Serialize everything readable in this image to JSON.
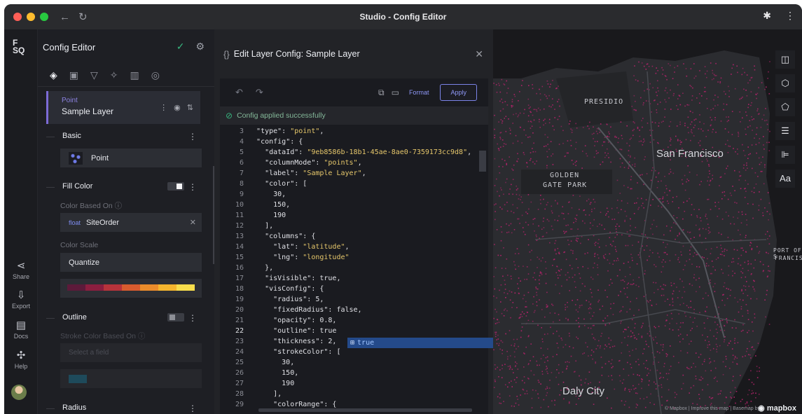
{
  "window": {
    "title": "Studio - Config Editor"
  },
  "titlebar": {
    "back_icon": "back-arrow-icon",
    "reload_icon": "reload-icon",
    "extensions_icon": "puzzle-icon",
    "menu_icon": "kebab-icon"
  },
  "rail": {
    "logo": "FSQ",
    "items": [
      {
        "label": "Share",
        "icon": "share-icon"
      },
      {
        "label": "Export",
        "icon": "export-icon"
      },
      {
        "label": "Docs",
        "icon": "docs-icon"
      },
      {
        "label": "Help",
        "icon": "help-icon"
      }
    ]
  },
  "sidepanel": {
    "title": "Config Editor",
    "tabs": [
      "layers",
      "interactions",
      "filters",
      "effects",
      "basemap",
      "search"
    ],
    "layer": {
      "type": "Point",
      "name": "Sample Layer"
    },
    "basic": {
      "label": "Basic",
      "value": "Point"
    },
    "fill": {
      "label": "Fill Color",
      "enabled": true,
      "based_on_label": "Color Based On",
      "field_type": "float",
      "field_name": "SiteOrder",
      "scale_label": "Color Scale",
      "scale_value": "Quantize"
    },
    "color_ramp": [
      "#5c1a3a",
      "#8b1e3f",
      "#b8333b",
      "#d85b2e",
      "#eb8c2b",
      "#f4b52e",
      "#f7dd4c"
    ],
    "outline": {
      "label": "Outline",
      "enabled": false,
      "stroke_label": "Stroke Color Based On",
      "stroke_placeholder": "Select a field"
    },
    "radius": {
      "label": "Radius"
    }
  },
  "editor": {
    "title": "Edit Layer Config: Sample Layer",
    "format_label": "Format",
    "apply_label": "Apply",
    "success_message": "Config applied successfully",
    "autocomplete": "true",
    "lines": [
      {
        "n": "3",
        "html": "  <span class='k'>\"type\"</span>: <span class='s'>\"point\"</span>,"
      },
      {
        "n": "4",
        "html": "  <span class='k'>\"config\"</span>: {"
      },
      {
        "n": "5",
        "html": "    <span class='k'>\"dataId\"</span>: <span class='s'>\"9eb8586b-18b1-45ae-8ae0-7359173cc9d8\"</span>,"
      },
      {
        "n": "6",
        "html": "    <span class='k'>\"columnMode\"</span>: <span class='s'>\"points\"</span>,"
      },
      {
        "n": "7",
        "html": "    <span class='k'>\"label\"</span>: <span class='s'>\"Sample Layer\"</span>,"
      },
      {
        "n": "8",
        "html": "    <span class='k'>\"color\"</span>: ["
      },
      {
        "n": "9",
        "html": "      30,"
      },
      {
        "n": "10",
        "html": "      150,"
      },
      {
        "n": "11",
        "html": "      190"
      },
      {
        "n": "12",
        "html": "    ],"
      },
      {
        "n": "13",
        "html": "    <span class='k'>\"columns\"</span>: {"
      },
      {
        "n": "14",
        "html": "      <span class='k'>\"lat\"</span>: <span class='s'>\"latitude\"</span>,"
      },
      {
        "n": "15",
        "html": "      <span class='k'>\"lng\"</span>: <span class='s'>\"longitude\"</span>"
      },
      {
        "n": "16",
        "html": "    },"
      },
      {
        "n": "17",
        "html": "    <span class='k'>\"isVisible\"</span>: true,"
      },
      {
        "n": "18",
        "html": "    <span class='k'>\"visConfig\"</span>: {"
      },
      {
        "n": "19",
        "html": "      <span class='k'>\"radius\"</span>: 5,"
      },
      {
        "n": "20",
        "html": "      <span class='k'>\"fixedRadius\"</span>: false,"
      },
      {
        "n": "21",
        "html": "      <span class='k'>\"opacity\"</span>: 0.8,"
      },
      {
        "n": "22",
        "html": "      <span class='k'>\"outline\"</span>: true"
      },
      {
        "n": "23",
        "html": "      <span class='k'>\"thickness\"</span>: 2,"
      },
      {
        "n": "24",
        "html": "      <span class='k'>\"strokeColor\"</span>: ["
      },
      {
        "n": "25",
        "html": "        30,"
      },
      {
        "n": "26",
        "html": "        150,"
      },
      {
        "n": "27",
        "html": "        190"
      },
      {
        "n": "28",
        "html": "      ],"
      },
      {
        "n": "29",
        "html": "      <span class='k'>\"colorRange\"</span>: {"
      }
    ],
    "current_line": "22"
  },
  "map": {
    "labels": {
      "presidio": "PRESIDIO",
      "golden_gate_1": "GOLDEN",
      "golden_gate_2": "GATE PARK",
      "port_1": "PORT OF S",
      "port_2": "FRANCISC"
    },
    "city": "San Francisco",
    "daly_city": "Daly City",
    "tools": [
      "split-map-icon",
      "3d-icon",
      "draw-polygon-icon",
      "legend-icon",
      "layer-order-icon",
      "labels-icon"
    ],
    "labels_tool": "Aa",
    "attribution": "© Mapbox | Improve this map | Basemap by",
    "brand": "mapbox",
    "point_color": "#b3236a",
    "land_color": "#2b2c30",
    "water_color": "#19191c"
  }
}
